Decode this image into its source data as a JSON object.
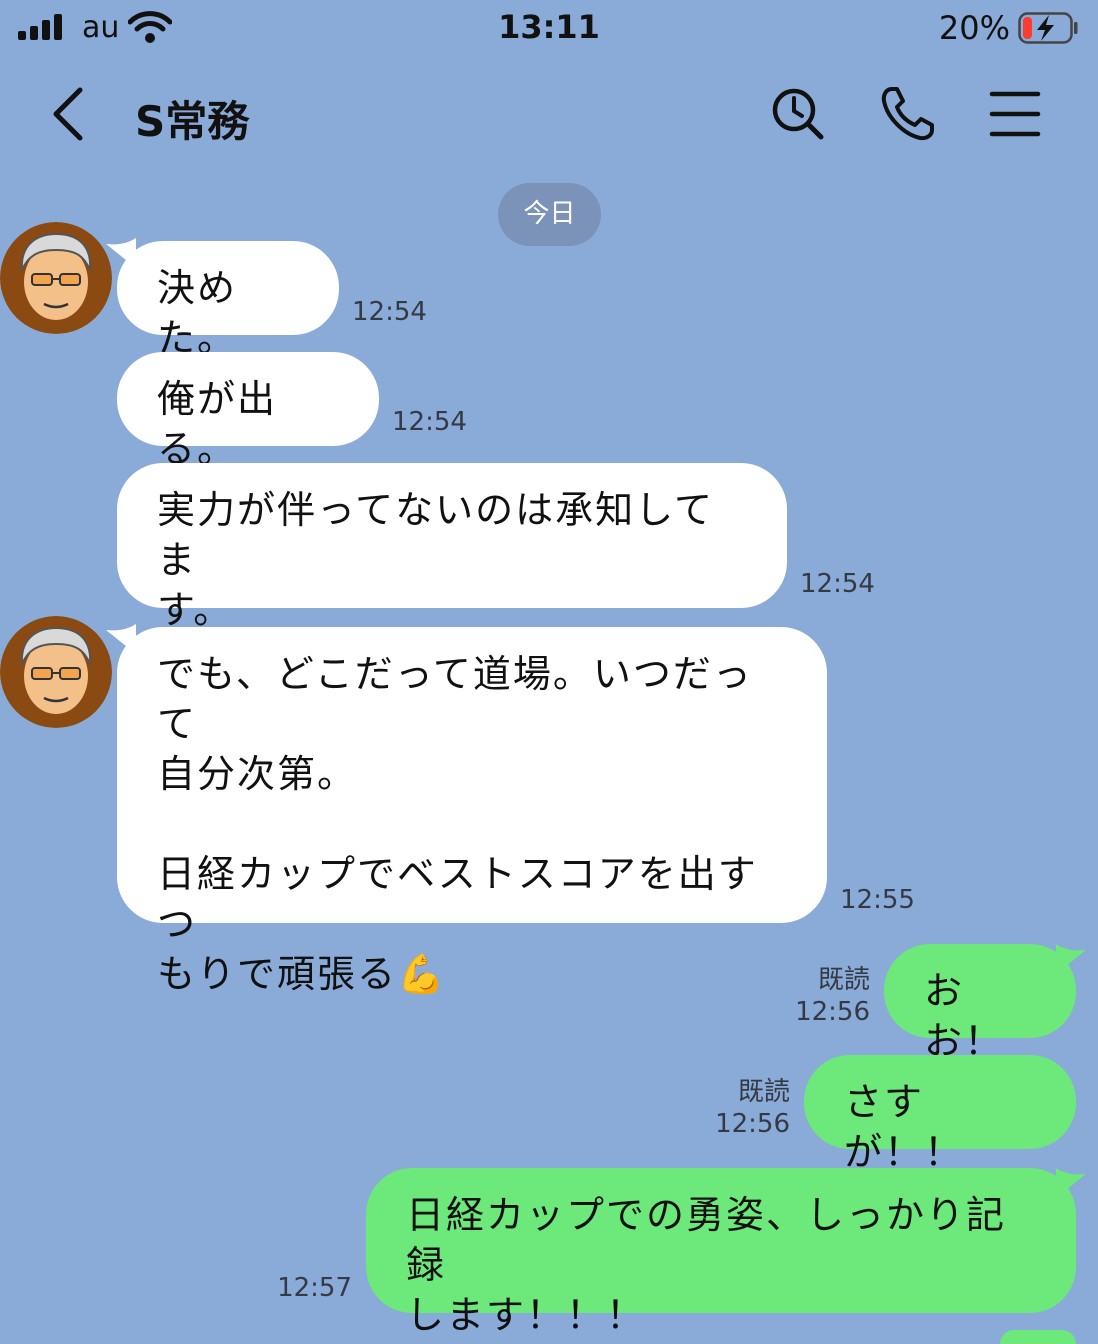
{
  "status_bar": {
    "carrier": "au",
    "time": "13:11",
    "battery_percent": "20%",
    "battery_level": 0.2,
    "charging": true
  },
  "header": {
    "title": "S常務",
    "back_icon": "chevron-left-icon",
    "icons": [
      "search-icon",
      "phone-icon",
      "menu-icon"
    ]
  },
  "date_separator": "今日",
  "messages": [
    {
      "side": "in",
      "text": "決めた。",
      "time": "12:54"
    },
    {
      "side": "in",
      "text": "俺が出る。",
      "time": "12:54"
    },
    {
      "side": "in",
      "text": "実力が伴ってないのは承知してま\nす。",
      "time": "12:54"
    },
    {
      "side": "in",
      "text": "でも、どこだって道場。いつだって\n自分次第。\n\n日経カップでベストスコアを出すつ\nもりで頑張る💪",
      "time": "12:55"
    },
    {
      "side": "out",
      "text": "おお！",
      "read": "既読",
      "time": "12:56"
    },
    {
      "side": "out",
      "text": "さすが！！",
      "read": "既読",
      "time": "12:56"
    },
    {
      "side": "out",
      "text": "日経カップでの勇姿、しっかり記録\nします！！！",
      "time": "12:57"
    }
  ],
  "colors": {
    "background": "#8aaad8",
    "incoming_bubble": "#ffffff",
    "outgoing_bubble": "#6de87a",
    "date_chip": "#7b93b9",
    "battery_low": "#ff3b30"
  }
}
